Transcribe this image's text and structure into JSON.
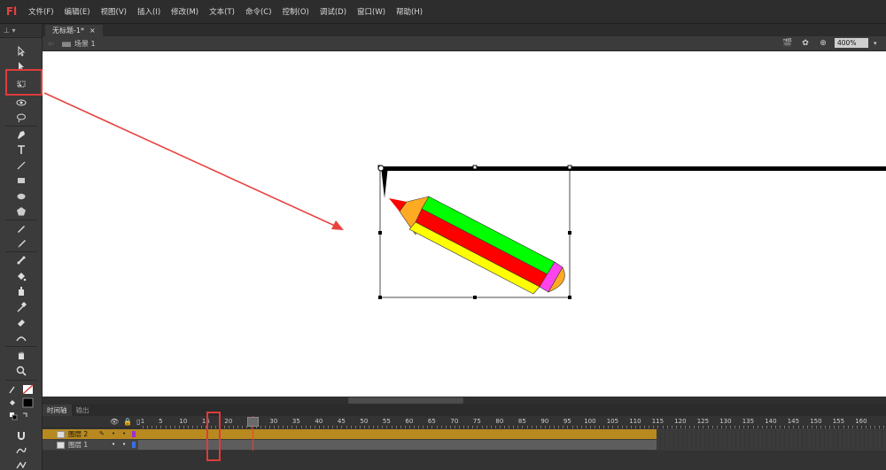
{
  "app": {
    "logo": "Fl"
  },
  "menu": [
    "文件(F)",
    "编辑(E)",
    "视图(V)",
    "插入(I)",
    "修改(M)",
    "文本(T)",
    "命令(C)",
    "控制(O)",
    "调试(D)",
    "窗口(W)",
    "帮助(H)"
  ],
  "document": {
    "tab_title": "无标题-1*",
    "close": "×"
  },
  "scene": {
    "label": "场景 1",
    "zoom": "400%"
  },
  "timeline": {
    "tabs": [
      "时间轴",
      "输出"
    ],
    "ruler": [
      "1",
      "5",
      "10",
      "15",
      "20",
      "25",
      "30",
      "35",
      "40",
      "45",
      "50",
      "55",
      "60",
      "65",
      "70",
      "75",
      "80",
      "85",
      "90",
      "95",
      "100",
      "105",
      "110",
      "115",
      "120",
      "125",
      "130",
      "135",
      "140",
      "145",
      "150",
      "155",
      "160"
    ],
    "layers": [
      {
        "name": "图层 2",
        "selected": true,
        "color": "#9a2ed1"
      },
      {
        "name": "图层 1",
        "selected": false,
        "color": "#3a6fe0"
      }
    ],
    "current_frame": 25,
    "last_frame": 115
  },
  "colors": {
    "highlight_red": "#e03b3b",
    "timeline_selected": "#b8891f",
    "pencil_green": "#00ff00",
    "pencil_red": "#ff0000",
    "pencil_yellow": "#ffff00",
    "pencil_orange": "#ffaa22",
    "pencil_eraser": "#ff44ee"
  }
}
